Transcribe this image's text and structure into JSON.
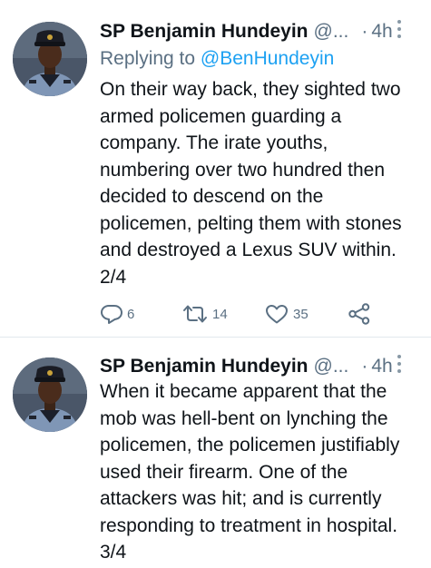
{
  "tweets": [
    {
      "author_name": "SP Benjamin Hundeyin",
      "handle": "@...",
      "separator": "·",
      "time": "4h",
      "replying_label": "Replying to",
      "replying_handle": "@BenHundeyin",
      "text_lines": [
        "On their way back, they sighted two",
        "armed policemen guarding a",
        "company. The irate youths,",
        "numbering over two hundred then",
        "decided to descend on the",
        "policemen, pelting them with stones",
        "and destroyed a Lexus SUV within.",
        "2/4"
      ],
      "reply_count": "6",
      "retweet_count": "14",
      "like_count": "35"
    },
    {
      "author_name": "SP Benjamin Hundeyin",
      "handle": "@...",
      "separator": "·",
      "time": "4h",
      "text_lines": [
        "When it became apparent that the",
        "mob was hell-bent on lynching the",
        "policemen, the policemen justifiably",
        "used their firearm. One of the",
        "attackers was hit; and is currently",
        "responding to treatment in hospital.",
        "3/4"
      ]
    }
  ],
  "icons": {
    "reply": "reply-icon",
    "retweet": "retweet-icon",
    "like": "heart-icon",
    "share": "share-icon",
    "more": "more-vertical-icon"
  },
  "colors": {
    "text": "#0f1419",
    "secondary": "#5b7083",
    "link": "#1da1f2",
    "divider": "#e1e8ed"
  }
}
